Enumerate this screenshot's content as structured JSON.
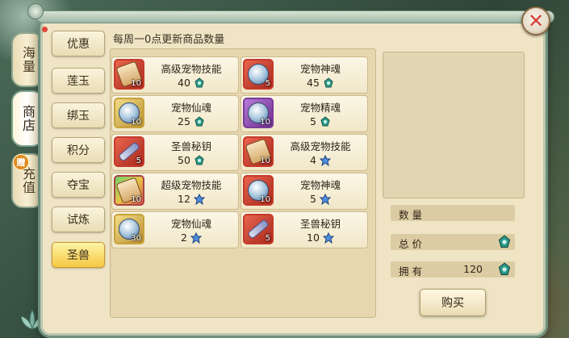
{
  "window": {
    "close_label": "✕"
  },
  "side_tabs": [
    {
      "label": "海量"
    },
    {
      "label": "商店"
    },
    {
      "label": "充值",
      "badge": "赠"
    }
  ],
  "categories": [
    {
      "label": "优惠"
    },
    {
      "label": "莲玉"
    },
    {
      "label": "绑玉"
    },
    {
      "label": "积分"
    },
    {
      "label": "夺宝"
    },
    {
      "label": "试炼"
    },
    {
      "label": "圣兽",
      "active": true
    }
  ],
  "header": {
    "text": "每周一0点更新商品数量"
  },
  "items": [
    {
      "name": "高级宠物技能",
      "price": "40",
      "count": "10",
      "icon": "skill-book-icon",
      "currency": "teal-jade-icon"
    },
    {
      "name": "宠物神魂",
      "price": "45",
      "count": "5",
      "icon": "soul-orb-icon",
      "currency": "teal-jade-icon"
    },
    {
      "name": "宠物仙魂",
      "price": "25",
      "count": "10",
      "icon": "immortal-orb-icon",
      "currency": "teal-jade-icon"
    },
    {
      "name": "宠物精魂",
      "price": "5",
      "count": "10",
      "icon": "essence-orb-icon",
      "currency": "teal-jade-icon"
    },
    {
      "name": "圣兽秘钥",
      "price": "50",
      "count": "5",
      "icon": "key-icon",
      "currency": "teal-jade-icon"
    },
    {
      "name": "高级宠物技能",
      "price": "4",
      "count": "10",
      "icon": "skill-book-icon",
      "currency": "blue-jade-icon"
    },
    {
      "name": "超级宠物技能",
      "price": "12",
      "count": "10",
      "icon": "super-skill-book-icon",
      "currency": "blue-jade-icon"
    },
    {
      "name": "宠物神魂",
      "price": "5",
      "count": "10",
      "icon": "soul-orb-icon",
      "currency": "blue-jade-icon"
    },
    {
      "name": "宠物仙魂",
      "price": "2",
      "count": "30",
      "icon": "immortal-orb-icon",
      "currency": "blue-jade-icon"
    },
    {
      "name": "圣兽秘钥",
      "price": "10",
      "count": "5",
      "icon": "key-icon",
      "currency": "blue-jade-icon"
    }
  ],
  "details": {
    "quantity_label": "数量",
    "total_label": "总价",
    "owned_label": "拥有",
    "owned_value": "120",
    "buy_label": "购买"
  },
  "colors": {
    "teal_currency": "#2e9a8a",
    "blue_currency": "#4f8fe0",
    "active_category": "#f5c843"
  }
}
